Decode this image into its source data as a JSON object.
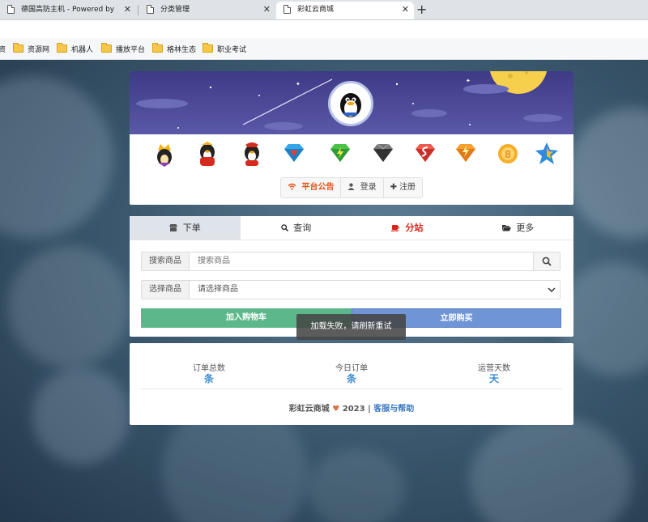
{
  "browser": {
    "tabs": [
      {
        "title": "德国高防主机 - Powered by 德国",
        "active": false
      },
      {
        "title": "分类管理",
        "active": false
      },
      {
        "title": "彩虹云商城",
        "active": true
      }
    ],
    "close_glyph": "✕",
    "new_tab_glyph": "+",
    "bookmarks": [
      {
        "label": "资",
        "icon": "folder-icon"
      },
      {
        "label": "资源网",
        "icon": "folder-icon"
      },
      {
        "label": "机器人",
        "icon": "folder-icon"
      },
      {
        "label": "播放平台",
        "icon": "folder-icon"
      },
      {
        "label": "格林生态",
        "icon": "folder-icon"
      },
      {
        "label": "职业考试",
        "icon": "folder-icon"
      }
    ]
  },
  "header": {
    "badge_icons": [
      "qq-crown-icon",
      "qq-penguin-red-icon",
      "qq-penguin-icon",
      "diamond-blue-icon",
      "diamond-green-icon",
      "diamond-black-icon",
      "diamond-red-icon",
      "diamond-orange-icon",
      "qq-orange-icon",
      "star-blue-icon"
    ],
    "buttons": {
      "notice": "平台公告",
      "login": "登录",
      "register": "注册"
    }
  },
  "order": {
    "tabs": {
      "order": "下单",
      "query": "查询",
      "branch": "分站",
      "more": "更多"
    },
    "search_label": "搜索商品",
    "search_placeholder": "搜索商品",
    "select_label": "选择商品",
    "select_value": "请选择商品",
    "add_cart": "加入购物车",
    "buy_now": "立即购买",
    "toast": "加载失败，请刷新重试"
  },
  "stats": {
    "items": [
      {
        "label": "订单总数",
        "value": "条"
      },
      {
        "label": "今日订单",
        "value": "条"
      },
      {
        "label": "运营天数",
        "value": "天"
      }
    ],
    "footer_brand": "彩虹云商城",
    "footer_year": "2023",
    "footer_sep": "|",
    "footer_link": "客服与帮助"
  },
  "colors": {
    "banner": "#4a4798",
    "add_cart": "#5cb88a",
    "buy_now": "#6f95d6",
    "accent_red": "#d8261a",
    "stat_value": "#3a8bd2"
  }
}
